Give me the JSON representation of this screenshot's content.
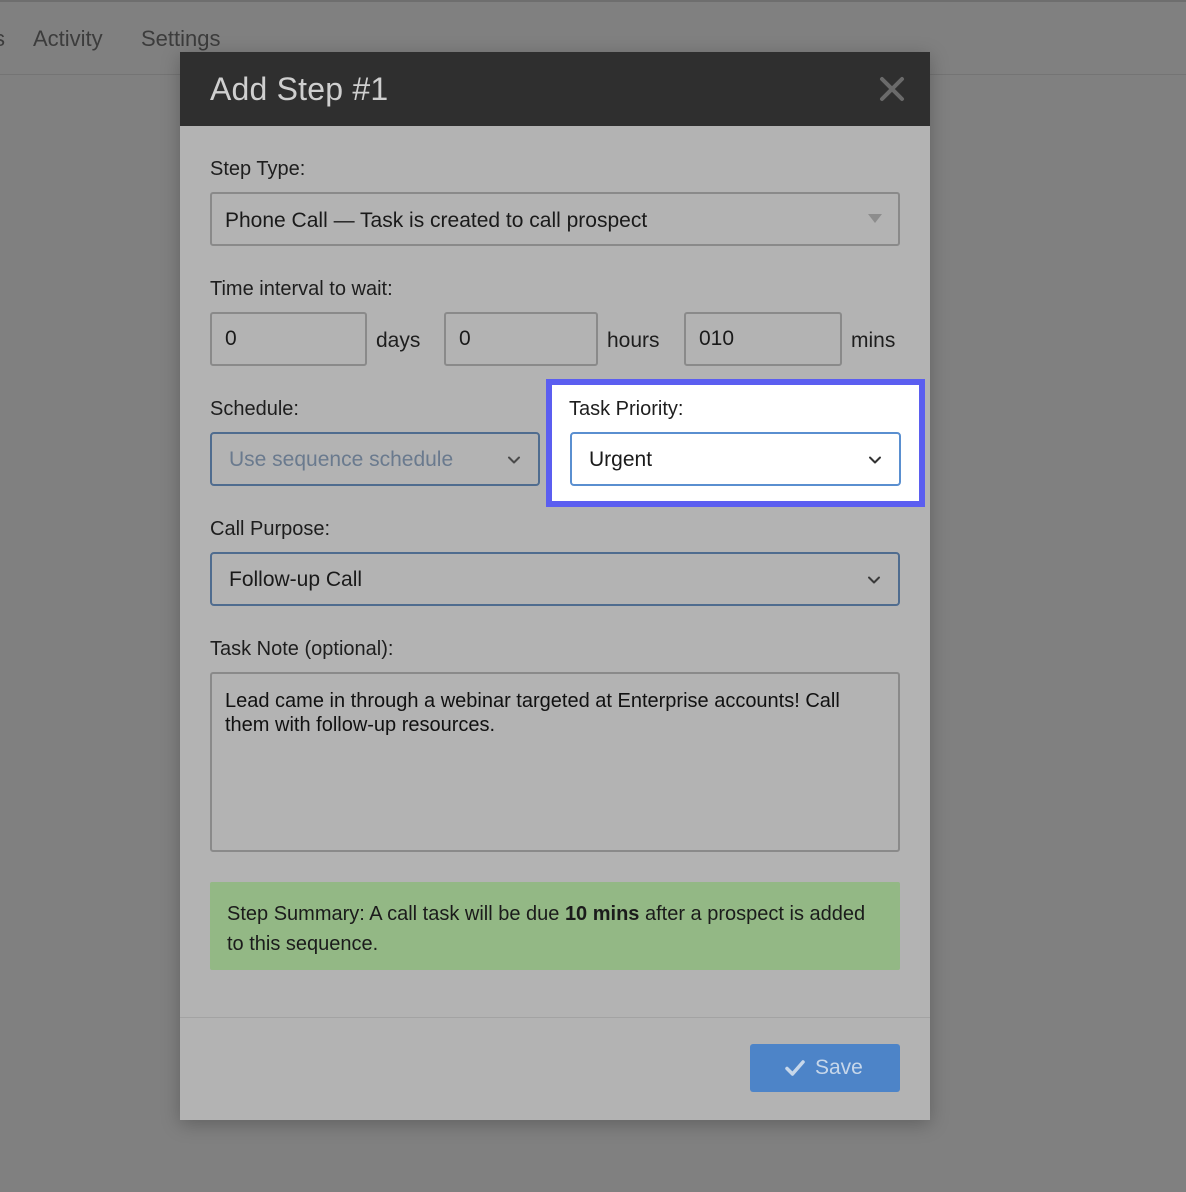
{
  "nav": {
    "items": [
      {
        "label": "s"
      },
      {
        "label": "Activity"
      },
      {
        "label": "Settings"
      }
    ]
  },
  "modal": {
    "title": "Add Step #1",
    "close_icon": "close-icon",
    "step_type": {
      "label": "Step Type:",
      "value": "Phone Call — Task is created to call prospect"
    },
    "interval": {
      "label": "Time interval to wait:",
      "days_value": "0",
      "days_unit": "days",
      "hours_value": "0",
      "hours_unit": "hours",
      "mins_value": "010",
      "mins_unit": "mins"
    },
    "schedule": {
      "label": "Schedule:",
      "value": "Use sequence schedule"
    },
    "task_priority": {
      "label": "Task Priority:",
      "value": "Urgent",
      "highlight_color": "#5b5ef0"
    },
    "call_purpose": {
      "label": "Call Purpose:",
      "value": "Follow-up Call"
    },
    "task_note": {
      "label": "Task Note (optional):",
      "value": "Lead came in through a webinar targeted at Enterprise accounts! Call them with follow-up resources."
    },
    "summary": {
      "prefix": "Step Summary: A call task will be due ",
      "bold": "10 mins",
      "suffix": " after a prospect is added to this sequence.",
      "color": "#93b885"
    },
    "save": {
      "label": "Save",
      "icon": "check-icon",
      "color": "#4d84c8"
    }
  }
}
